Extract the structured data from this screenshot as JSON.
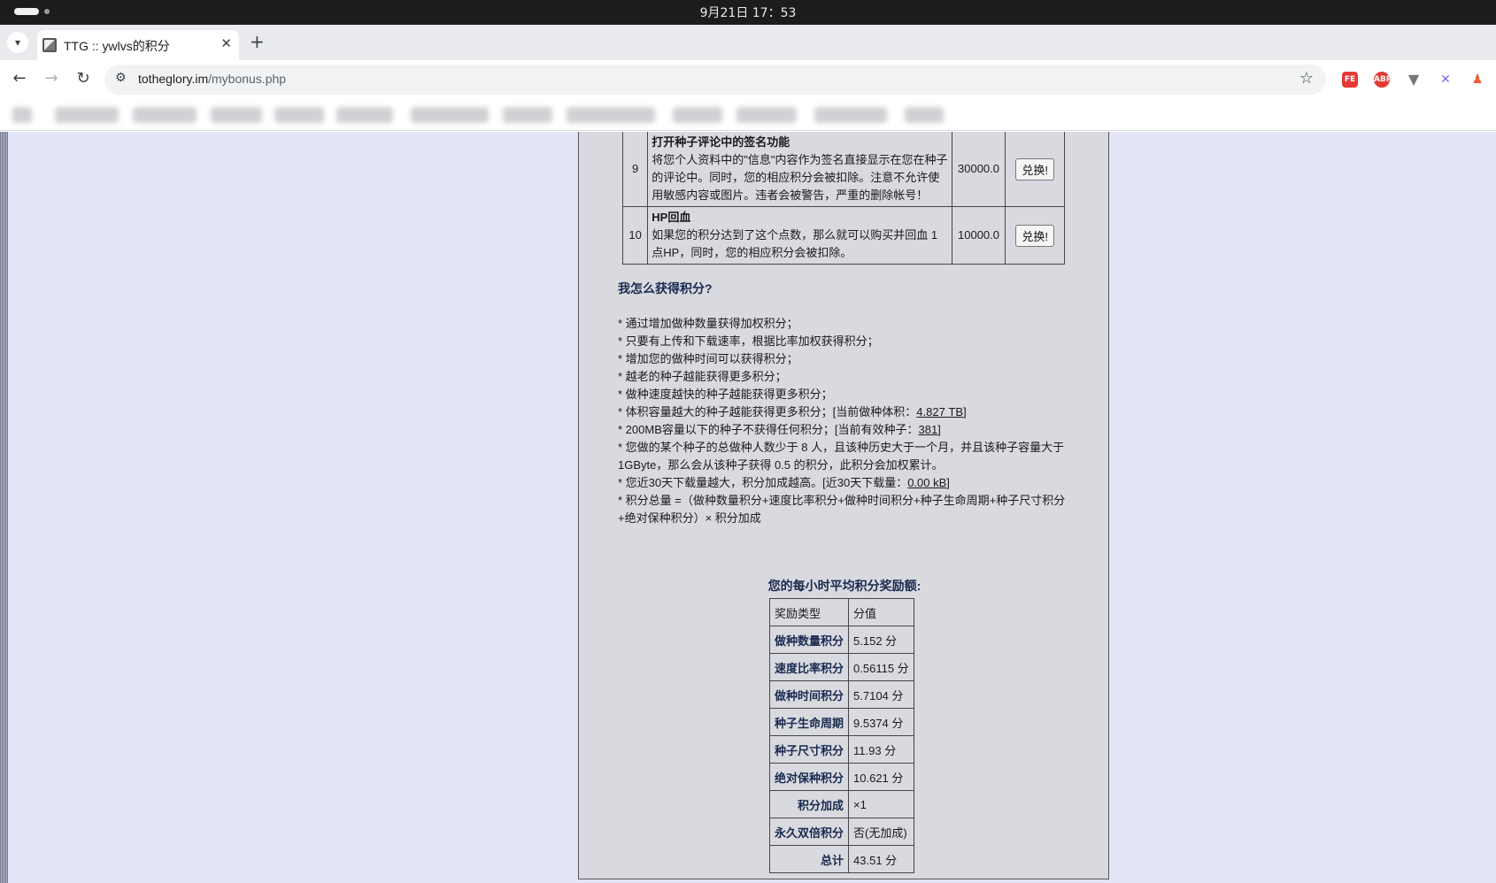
{
  "os": {
    "clock": "9月21日 17：53"
  },
  "browser": {
    "tab": {
      "title": "TTG :: ywlvs的积分"
    },
    "url_host": "totheglory.im",
    "url_path": "/mybonus.php"
  },
  "exchange_rows": [
    {
      "no": "9",
      "title": "打开种子评论中的签名功能",
      "desc": "将您个人资料中的\"信息\"内容作为签名直接显示在您在种子的评论中。同时，您的相应积分会被扣除。注意不允许使用敏感内容或图片。违者会被警告，严重的删除帐号！",
      "cost": "30000.0",
      "button": "兑换!"
    },
    {
      "no": "10",
      "title": "HP回血",
      "desc": "如果您的积分达到了这个点数，那么就可以购买并回血 1 点HP，同时，您的相应积分会被扣除。",
      "cost": "10000.0",
      "button": "兑换!"
    }
  ],
  "how": {
    "title": "我怎么获得积分?",
    "items": [
      "* 通过增加做种数量获得加权积分；",
      "* 只要有上传和下载速率，根据比率加权获得积分；",
      "* 增加您的做种时间可以获得积分；",
      "* 越老的种子越能获得更多积分；",
      "* 做种速度越快的种子越能获得更多积分；",
      "* 200MB容量以下的种子不获得任何积分；",
      "* 您做的某个种子的总做种人数少于 8 人，且该种历史大于一个月，并且该种子容量大于 1GByte，那么会从该种子获得 0.5 的积分，此积分会加权累计。",
      "* 积分总量 =（做种数量积分+速度比率积分+做种时间积分+种子生命周期+种子尺寸积分+绝对保种积分）× 积分加成"
    ],
    "volume_prefix": "* 体积容量越大的种子越能获得更多积分；[当前做种体积：",
    "volume_value": "4.827 TB",
    "seeds_prefix": "* 200MB容量以下的种子不获得任何积分；[当前有效种子：",
    "seeds_value": "381",
    "dl_prefix": "* 您近30天下载量越大，积分加成越高。[近30天下载量：",
    "dl_value": "0.00 kB",
    "close_bracket": "]"
  },
  "rates": {
    "title": "您的每小时平均积分奖励额:",
    "head": [
      "奖励类型",
      "分值"
    ],
    "rows": [
      {
        "label": "做种数量积分",
        "value": "5.152 分"
      },
      {
        "label": "速度比率积分",
        "value": "0.56115 分"
      },
      {
        "label": "做种时间积分",
        "value": "5.7104 分"
      },
      {
        "label": "种子生命周期",
        "value": "9.5374 分"
      },
      {
        "label": "种子尺寸积分",
        "value": "11.93 分"
      },
      {
        "label": "绝对保种积分",
        "value": "10.621 分"
      },
      {
        "label": "积分加成",
        "value": "×1"
      },
      {
        "label": "永久双倍积分",
        "value": "否(无加成)"
      },
      {
        "label": "总计",
        "value": "43.51 分"
      }
    ]
  }
}
